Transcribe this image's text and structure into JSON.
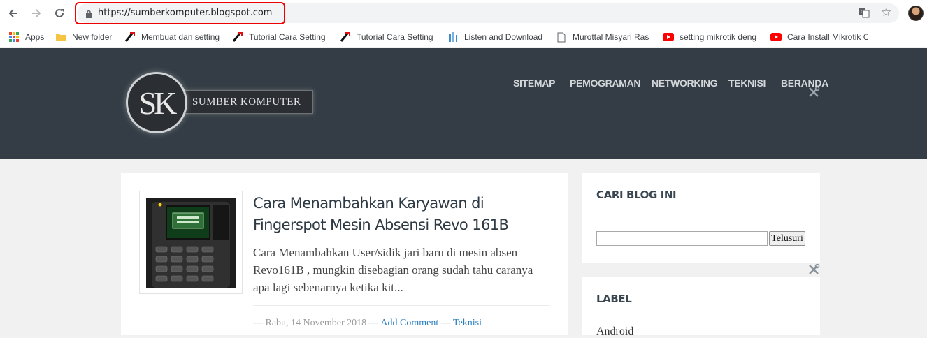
{
  "browser": {
    "url": "https://sumberkomputer.blogspot.com",
    "bookmarks": [
      {
        "label": "Apps",
        "icon": "apps-grid-icon"
      },
      {
        "label": "New folder",
        "icon": "folder-icon"
      },
      {
        "label": "Membuat dan setting",
        "icon": "mikrotik-icon"
      },
      {
        "label": "Tutorial Cara Setting",
        "icon": "mikrotik-icon"
      },
      {
        "label": "Tutorial Cara Setting",
        "icon": "mikrotik-icon"
      },
      {
        "label": "Listen and Download",
        "icon": "music-icon"
      },
      {
        "label": "Murottal Misyari Ras",
        "icon": "page-icon"
      },
      {
        "label": "setting mikrotik deng",
        "icon": "youtube-icon"
      },
      {
        "label": "Cara Install Mikrotik C",
        "icon": "youtube-icon"
      }
    ]
  },
  "site": {
    "logo_letters": "SK",
    "logo_text": "SUMBER KOMPUTER",
    "nav": [
      "SITEMAP",
      "PEMOGRAMAN",
      "NETWORKING",
      "TEKNISI",
      "BERANDA"
    ]
  },
  "post": {
    "title": "Cara Menambahkan Karyawan di Fingerspot Mesin Absensi Revo 161B",
    "snippet": "Cara Menambahkan User/sidik jari baru di mesin absen Revo161B , mungkin disebagian orang sudah tahu caranya apa lagi sebenarnya ketika kit...",
    "meta_prefix": "— Rabu, 14 November 2018 —",
    "comment_link": "Add Comment",
    "meta_sep": "—",
    "category": "Teknisi"
  },
  "sidebar": {
    "search_title": "CARI BLOG INI",
    "search_button": "Telusuri",
    "search_value": "",
    "label_title": "LABEL",
    "labels": [
      "Android"
    ]
  },
  "colors": {
    "header_bg": "#343d45",
    "link": "#2a7fc0",
    "highlight": "#ee0000"
  }
}
